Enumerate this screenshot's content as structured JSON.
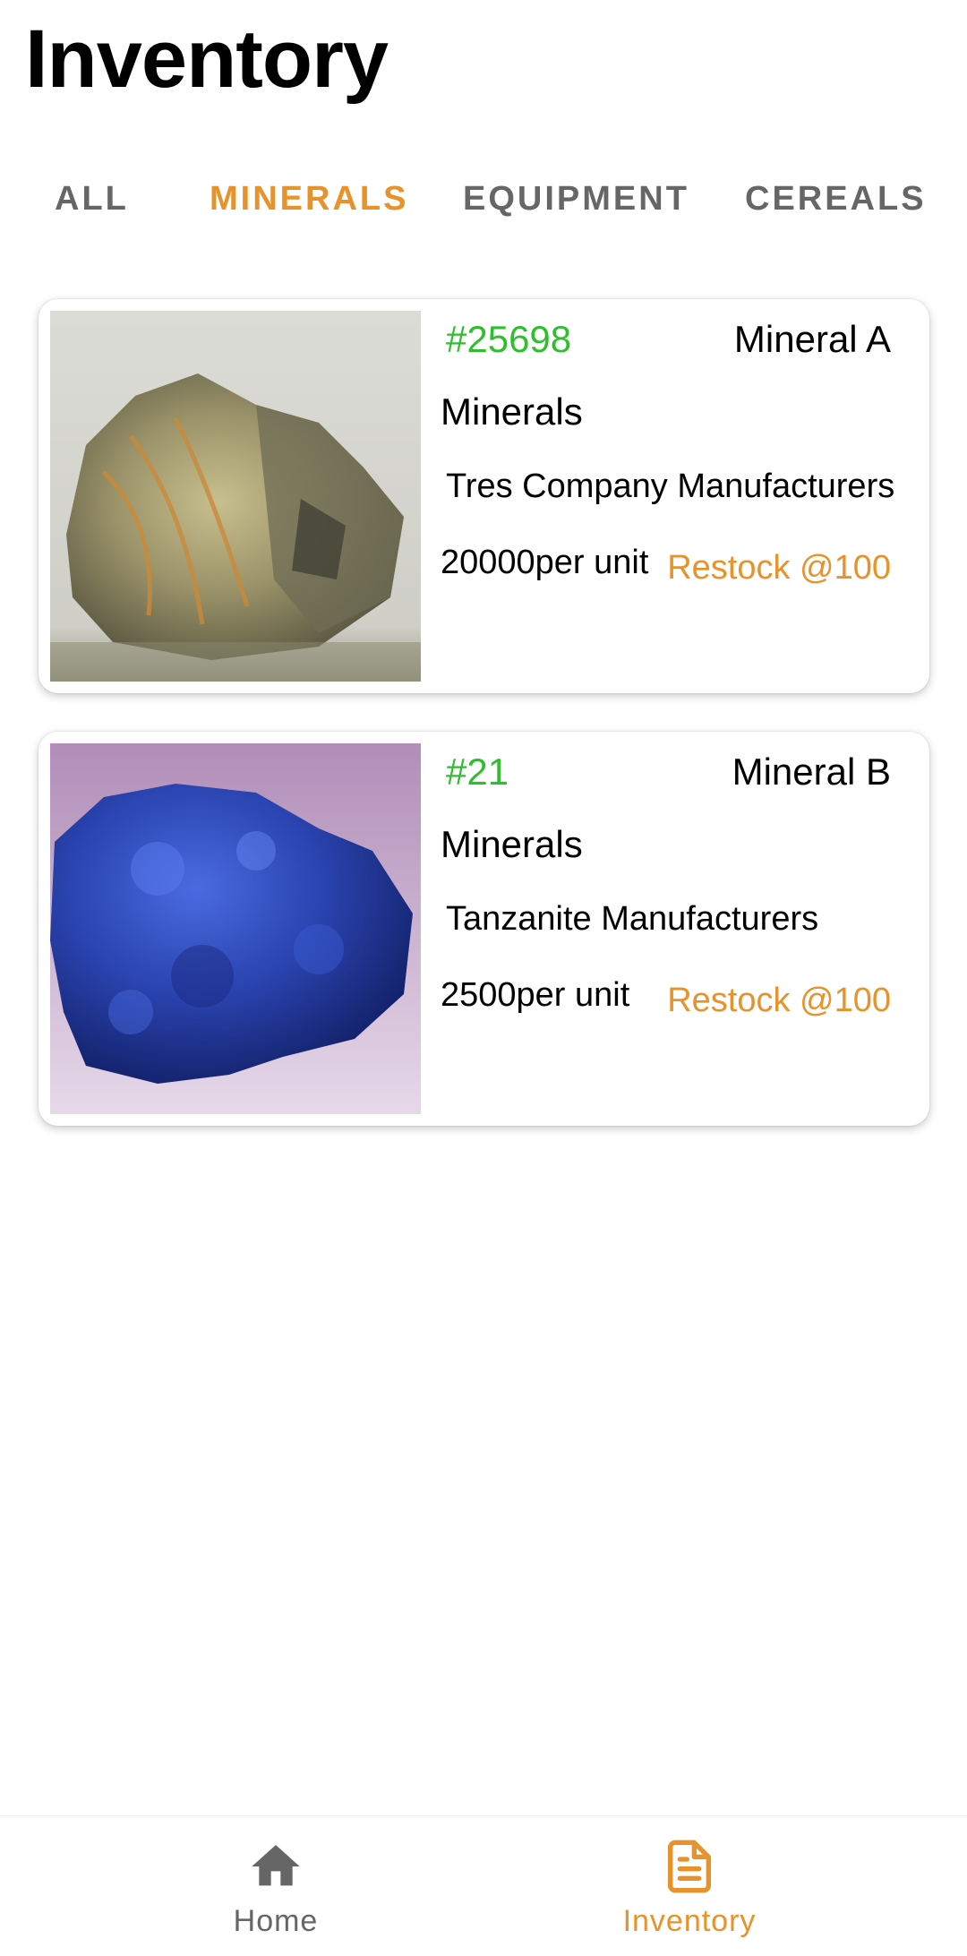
{
  "header": {
    "title": "Inventory"
  },
  "tabs": [
    {
      "label": "ALL",
      "active": false
    },
    {
      "label": "MINERALS",
      "active": true
    },
    {
      "label": "EQUIPMENT",
      "active": false
    },
    {
      "label": "CEREALS",
      "active": false
    }
  ],
  "items": [
    {
      "id": "#25698",
      "name": "Mineral A",
      "category": "Minerals",
      "manufacturer": "Tres Company Manufacturers",
      "price": "20000per unit",
      "restock": "Restock @100",
      "image": "mineral-a-photo"
    },
    {
      "id": "#21",
      "name": "Mineral B",
      "category": "Minerals",
      "manufacturer": "Tanzanite Manufacturers",
      "price": "2500per unit",
      "restock": "Restock @100",
      "image": "mineral-b-photo"
    }
  ],
  "bottom_nav": {
    "home": {
      "label": "Home",
      "icon": "home-icon",
      "active": false
    },
    "inventory": {
      "label": "Inventory",
      "icon": "document-icon",
      "active": true
    }
  },
  "colors": {
    "accent": "#E8922B",
    "id_green": "#2EBE2E",
    "tab_inactive": "#666666"
  }
}
